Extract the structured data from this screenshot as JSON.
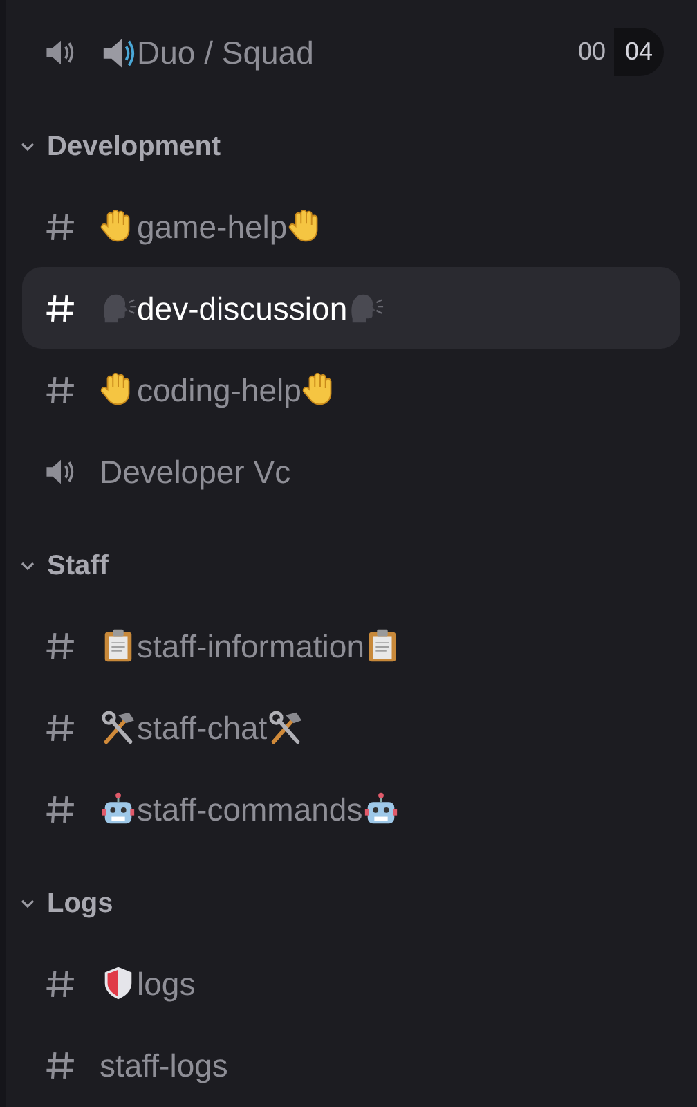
{
  "top_channels": [
    {
      "name": "Duo / Squad",
      "kind": "voice",
      "emoji_left": {
        "kind": "loudspeaker"
      },
      "selected": false,
      "user_count": "00",
      "user_limit": "04"
    }
  ],
  "categories": [
    {
      "name": "Development",
      "expanded": true,
      "channels": [
        {
          "name": "game-help",
          "kind": "text",
          "emoji_left": {
            "kind": "hand"
          },
          "emoji_right": {
            "kind": "hand"
          },
          "selected": false
        },
        {
          "name": "dev-discussion",
          "kind": "text",
          "emoji_left": {
            "kind": "speaking-head"
          },
          "emoji_right": {
            "kind": "speaking-head"
          },
          "selected": true
        },
        {
          "name": "coding-help",
          "kind": "text",
          "emoji_left": {
            "kind": "hand"
          },
          "emoji_right": {
            "kind": "hand"
          },
          "selected": false
        },
        {
          "name": "Developer Vc",
          "kind": "voice",
          "selected": false
        }
      ]
    },
    {
      "name": "Staff",
      "expanded": true,
      "channels": [
        {
          "name": "staff-information",
          "kind": "text",
          "emoji_left": {
            "kind": "clipboard"
          },
          "emoji_right": {
            "kind": "clipboard"
          },
          "selected": false
        },
        {
          "name": "staff-chat",
          "kind": "text",
          "emoji_left": {
            "kind": "tools"
          },
          "emoji_right": {
            "kind": "tools"
          },
          "selected": false
        },
        {
          "name": "staff-commands",
          "kind": "text",
          "emoji_left": {
            "kind": "robot"
          },
          "emoji_right": {
            "kind": "robot"
          },
          "selected": false
        }
      ]
    },
    {
      "name": "Logs",
      "expanded": true,
      "channels": [
        {
          "name": "logs",
          "kind": "text",
          "emoji_left": {
            "kind": "shield"
          },
          "selected": false
        },
        {
          "name": "staff-logs",
          "kind": "text",
          "selected": false
        }
      ]
    }
  ]
}
